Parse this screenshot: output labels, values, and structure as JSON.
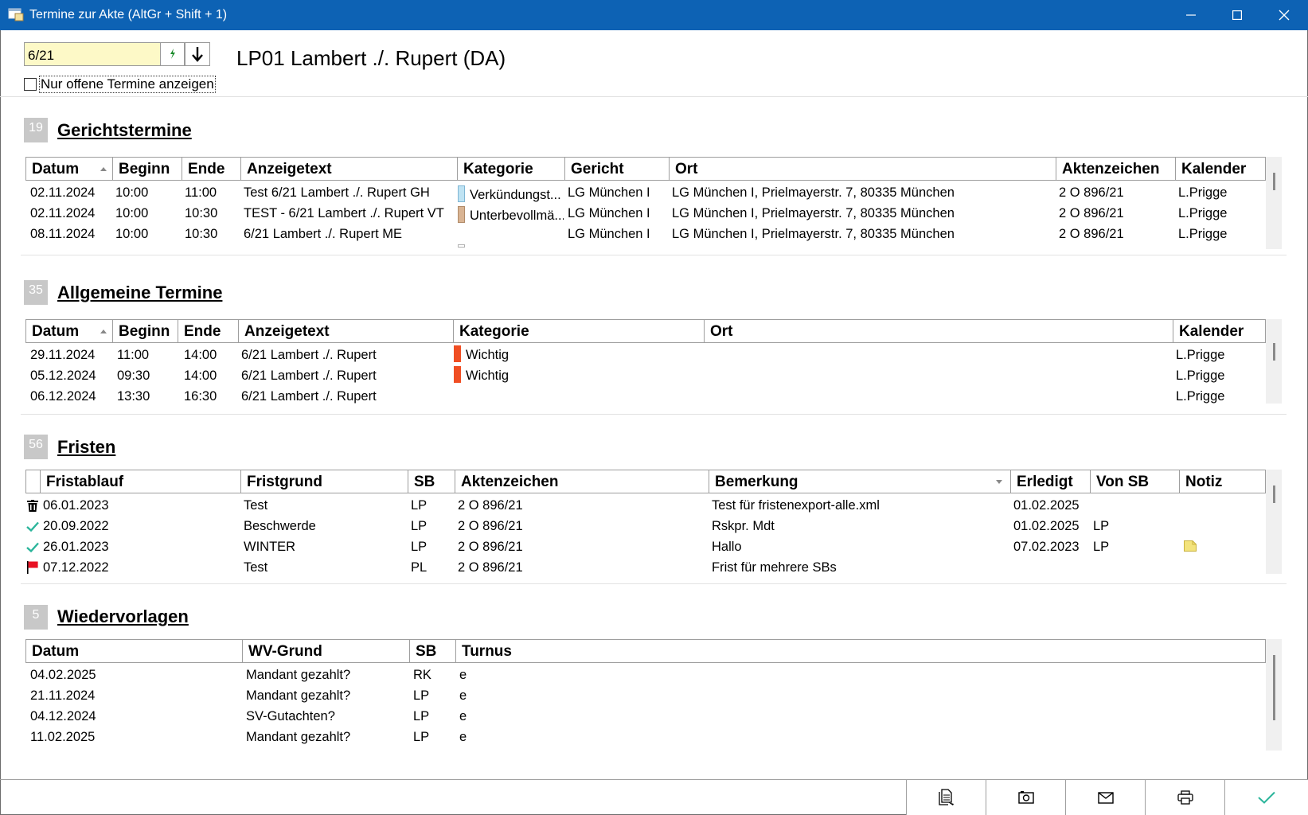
{
  "window": {
    "title": "Termine zur Akte (AltGr + Shift + 1)",
    "minimize_icon": "minimize-icon",
    "maximize_icon": "maximize-icon",
    "close_icon": "close-icon"
  },
  "header": {
    "file_number_value": "6/21",
    "only_open_label": "Nur offene Termine anzeigen",
    "only_open_checked": false,
    "akte_title": "LP01 Lambert ./. Rupert (DA)"
  },
  "gericht": {
    "count": "19",
    "title": "Gerichtstermine",
    "columns": [
      "Datum",
      "Beginn",
      "Ende",
      "Anzeigetext",
      "Kategorie",
      "Gericht",
      "Ort",
      "Aktenzeichen",
      "Kalender"
    ],
    "rows": [
      {
        "datum": "02.11.2024",
        "beginn": "10:00",
        "ende": "11:00",
        "text": "Test 6/21 Lambert ./. Rupert GH",
        "kategorie": "Verkündungst...",
        "kat_color": "#bfe3f3",
        "gericht": "LG München I",
        "ort": "LG München I, Prielmayerstr. 7, 80335 München",
        "az": "2 O 896/21",
        "kalender": "L.Prigge"
      },
      {
        "datum": "02.11.2024",
        "beginn": "10:00",
        "ende": "10:30",
        "text": "TEST - 6/21 Lambert ./. Rupert VT",
        "kategorie": "Unterbevollmä...",
        "kat_color": "#d9b493",
        "gericht": "LG München I",
        "ort": "LG München I, Prielmayerstr. 7, 80335 München",
        "az": "2 O 896/21",
        "kalender": "L.Prigge"
      },
      {
        "datum": "08.11.2024",
        "beginn": "10:00",
        "ende": "10:30",
        "text": "6/21 Lambert ./. Rupert ME",
        "kategorie": "",
        "kat_color": "",
        "gericht": "LG München I",
        "ort": "LG München I, Prielmayerstr. 7, 80335 München",
        "az": "2 O 896/21",
        "kalender": "L.Prigge"
      }
    ]
  },
  "allgemein": {
    "count": "35",
    "title": "Allgemeine Termine",
    "columns": [
      "Datum",
      "Beginn",
      "Ende",
      "Anzeigetext",
      "Kategorie",
      "Ort",
      "Kalender"
    ],
    "rows": [
      {
        "datum": "29.11.2024",
        "beginn": "11:00",
        "ende": "14:00",
        "text": "6/21 Lambert ./. Rupert",
        "kategorie": "Wichtig",
        "kat_color": "#f04e23",
        "ort": "",
        "kalender": "L.Prigge"
      },
      {
        "datum": "05.12.2024",
        "beginn": "09:30",
        "ende": "14:00",
        "text": "6/21 Lambert ./. Rupert",
        "kategorie": "Wichtig",
        "kat_color": "#f04e23",
        "ort": "",
        "kalender": "L.Prigge"
      },
      {
        "datum": "06.12.2024",
        "beginn": "13:30",
        "ende": "16:30",
        "text": "6/21 Lambert ./. Rupert",
        "kategorie": "",
        "kat_color": "",
        "ort": "",
        "kalender": "L.Prigge"
      }
    ]
  },
  "fristen": {
    "count": "56",
    "title": "Fristen",
    "columns": [
      "",
      "Fristablauf",
      "Fristgrund",
      "SB",
      "Aktenzeichen",
      "Bemerkung",
      "Erledigt",
      "Von SB",
      "Notiz"
    ],
    "rows": [
      {
        "icon": "trash-icon",
        "ablauf": "06.01.2023",
        "grund": "Test",
        "sb": "LP",
        "az": "2 O 896/21",
        "bemerkung": "Test für fristenexport-alle.xml",
        "erledigt": "01.02.2025",
        "von_sb": "",
        "notiz": ""
      },
      {
        "icon": "check-icon",
        "ablauf": "20.09.2022",
        "grund": "Beschwerde",
        "sb": "LP",
        "az": "2 O 896/21",
        "bemerkung": "Rskpr. Mdt",
        "erledigt": "01.02.2025",
        "von_sb": "LP",
        "notiz": ""
      },
      {
        "icon": "check-icon",
        "ablauf": "26.01.2023",
        "grund": "WINTER",
        "sb": "LP",
        "az": "2 O 896/21",
        "bemerkung": "Hallo",
        "erledigt": "07.02.2023",
        "von_sb": "LP",
        "notiz": "note-icon"
      },
      {
        "icon": "flag-icon",
        "ablauf": "07.12.2022",
        "grund": "Test",
        "sb": "PL",
        "az": "2 O 896/21",
        "bemerkung": "Frist für mehrere SBs",
        "erledigt": "",
        "von_sb": "",
        "notiz": ""
      }
    ]
  },
  "wv": {
    "count": "5",
    "title": "Wiedervorlagen",
    "columns": [
      "Datum",
      "WV-Grund",
      "SB",
      "Turnus"
    ],
    "rows": [
      {
        "datum": "04.02.2025",
        "grund": "Mandant gezahlt?",
        "sb": "RK",
        "turnus": "e"
      },
      {
        "datum": "21.11.2024",
        "grund": "Mandant gezahlt?",
        "sb": "LP",
        "turnus": "e"
      },
      {
        "datum": "04.12.2024",
        "grund": "SV-Gutachten?",
        "sb": "LP",
        "turnus": "e"
      },
      {
        "datum": "11.02.2025",
        "grund": "Mandant gezahlt?",
        "sb": "LP",
        "turnus": "e"
      }
    ]
  },
  "footer": {
    "buttons": [
      "copy-document-icon",
      "camera-icon",
      "mail-icon",
      "print-icon",
      "confirm-check-icon"
    ]
  },
  "colors": {
    "titlebar": "#0d62b4",
    "input_bg": "#fdf9c7",
    "badge": "#c8c8c8",
    "check": "#2bb59b",
    "flag": "#e81123",
    "note": "#f3e37c"
  }
}
